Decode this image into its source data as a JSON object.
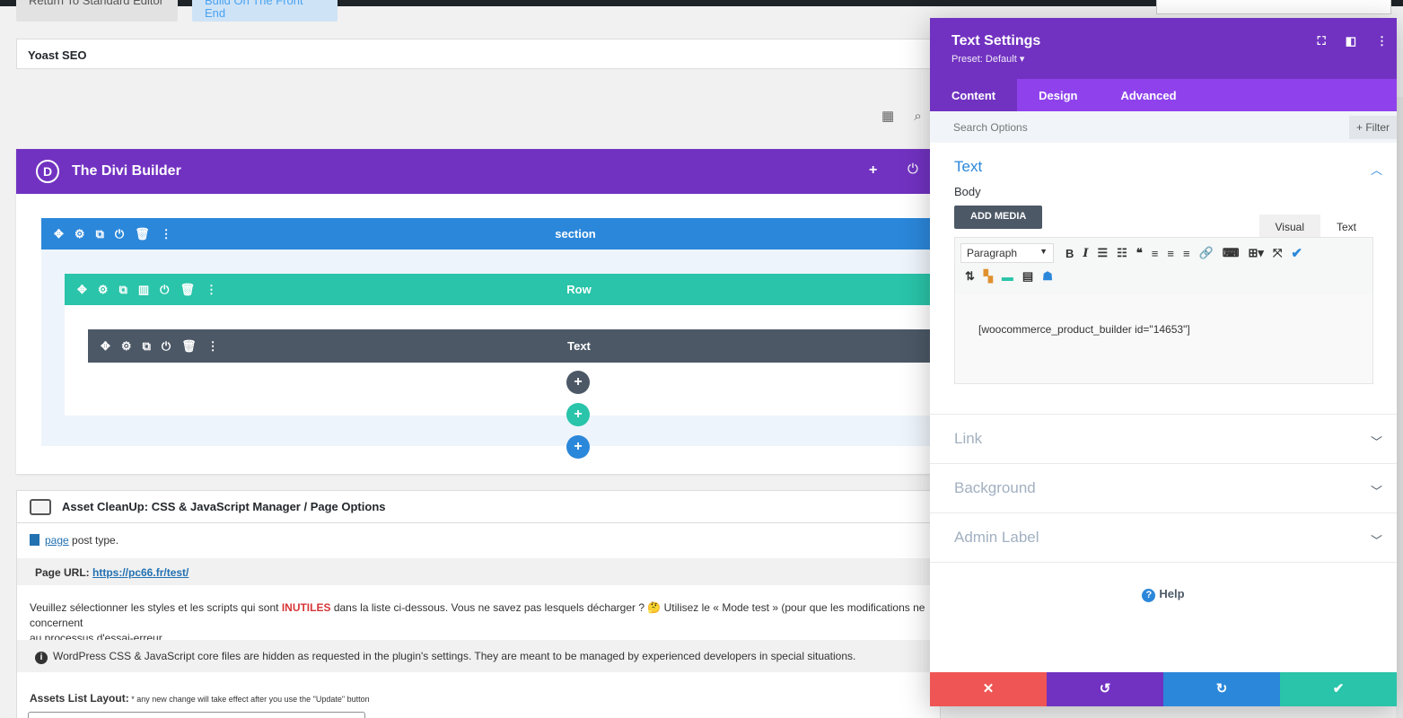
{
  "top": {
    "return_label": "Return To Standard Editor",
    "frontend_label": "Build On The Front End"
  },
  "yoast": {
    "label": "Yoast SEO"
  },
  "divi": {
    "title": "The Divi Builder",
    "logo_letter": "D",
    "section_label": "section",
    "row_label": "Row",
    "text_label": "Text"
  },
  "asset": {
    "title": "Asset CleanUp: CSS & JavaScript Manager / Page Options",
    "post_type_link": "page",
    "post_type_suffix": " post type.",
    "page_url_label": "Page URL: ",
    "page_url": "https://pc66.fr/test/",
    "notice_prefix": "Veuillez sélectionner les styles et les scripts qui sont ",
    "notice_strong": "INUTILES",
    "notice_suffix": " dans la liste ci-dessous. Vous ne savez pas lesquels décharger ? 🤔 Utilisez le « Mode test » (pour que les modifications ne concernent",
    "notice_line2": "au processus d'essai-erreur.",
    "core_notice": "WordPress CSS & JavaScript core files are hidden as requested in the plugin's settings. They are meant to be managed by experienced developers in special situations.",
    "layout_label": "Assets List Layout:",
    "layout_hint": " * any new change will take effect after you use the \"Update\" button"
  },
  "modal": {
    "title": "Text Settings",
    "preset": "Preset: Default ▾",
    "tabs": [
      {
        "label": "Content"
      },
      {
        "label": "Design"
      },
      {
        "label": "Advanced"
      }
    ],
    "search_placeholder": "Search Options",
    "filter_label": "+ Filter",
    "toggles": {
      "text": "Text",
      "link": "Link",
      "background": "Background",
      "admin_label": "Admin Label"
    },
    "body_label": "Body",
    "add_media": "ADD MEDIA",
    "visual_tab": "Visual",
    "text_tab": "Text",
    "format_select": "Paragraph",
    "editor_content": "[woocommerce_product_builder id=\"14653\"]",
    "help_label": "Help"
  },
  "colors": {
    "divi_purple": "#7132c1",
    "section_blue": "#2b87da",
    "row_green": "#29c4a9",
    "module_gray": "#4c5866",
    "cancel_red": "#ef5555"
  }
}
